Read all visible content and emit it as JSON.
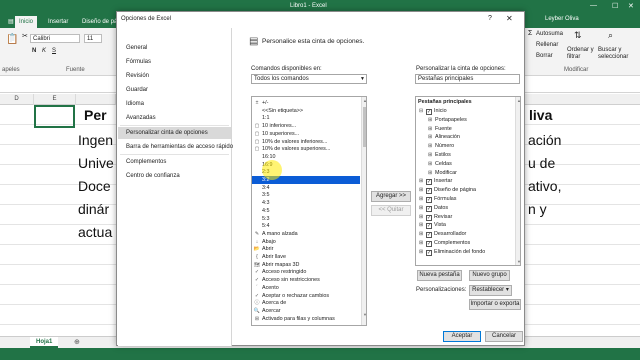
{
  "excel": {
    "window_title": "Libro1 - Excel",
    "user": "Leyber Oliva",
    "ribbon_tabs": [
      "Inicio",
      "Insertar",
      "Diseño de pá"
    ],
    "active_tab": "Inicio",
    "font_name": "Calibri",
    "font_size": "11",
    "clipboard_label": "apeles",
    "font_group_label": "Fuente",
    "autosum_label": "Autosuma",
    "fill_label": "Rellenar",
    "clear_label": "Borrar",
    "sort_label": "Ordenar y\nfiltrar",
    "find_label": "Buscar y\nseleccionar",
    "modify_group_label": "Modificar",
    "columns": [
      "D",
      "E"
    ],
    "doc_text": {
      "left_bold": "Per",
      "right_bold": "liva",
      "left_lines": [
        "Ingen",
        "Unive",
        "Doce",
        "dinár",
        "actua"
      ],
      "right_lines": [
        "ación",
        "u de",
        "ativo,",
        "n   y"
      ]
    },
    "sheet_tab": "Hoja1"
  },
  "dialog": {
    "title": "Opciones de Excel",
    "help": "?",
    "close": "✕",
    "nav": [
      "General",
      "Fórmulas",
      "Revisión",
      "Guardar",
      "Idioma",
      "Avanzadas",
      "Personalizar cinta de opciones",
      "Barra de herramientas de acceso rápido",
      "Complementos",
      "Centro de confianza"
    ],
    "selected_nav": "Personalizar cinta de opciones",
    "heading": "Personalice esta cinta de opciones.",
    "commands_label": "Comandos disponibles en:",
    "commands_value": "Todos los comandos",
    "customize_label": "Personalizar la cinta de opciones:",
    "customize_value": "Pestañas principales",
    "commands": [
      "+/-",
      "<<Sin etiqueta>>",
      "1:1",
      "10 inferiores...",
      "10 superiores...",
      "10% de valores inferiores...",
      "10% de valores superiores...",
      "16:10",
      "16:9",
      "2:3",
      "3:2",
      "3:4",
      "3:5",
      "4:3",
      "4:5",
      "5:3",
      "5:4",
      "A mano alzada",
      "Abajo",
      "Abrir",
      "Abrir llave",
      "Abrir mapas 3D",
      "Acceso restringido",
      "Acceso sin restricciones",
      "Acento",
      "Aceptar o rechazar cambios",
      "Acerca de",
      "Acercar",
      "Activado para filas y columnas"
    ],
    "highlighted_command_index": 10,
    "tree_header": "Pestañas principales",
    "tree": [
      {
        "label": "Inicio",
        "level": 1,
        "expander": "⊟",
        "checked": true
      },
      {
        "label": "Portapapeles",
        "level": 2,
        "expander": "⊞",
        "checked": null
      },
      {
        "label": "Fuente",
        "level": 2,
        "expander": "⊞",
        "checked": null
      },
      {
        "label": "Alineación",
        "level": 2,
        "expander": "⊞",
        "checked": null
      },
      {
        "label": "Número",
        "level": 2,
        "expander": "⊞",
        "checked": null
      },
      {
        "label": "Estilos",
        "level": 2,
        "expander": "⊞",
        "checked": null
      },
      {
        "label": "Celdas",
        "level": 2,
        "expander": "⊞",
        "checked": null
      },
      {
        "label": "Modificar",
        "level": 2,
        "expander": "⊞",
        "checked": null
      },
      {
        "label": "Insertar",
        "level": 1,
        "expander": "⊞",
        "checked": true
      },
      {
        "label": "Diseño de página",
        "level": 1,
        "expander": "⊞",
        "checked": true
      },
      {
        "label": "Fórmulas",
        "level": 1,
        "expander": "⊞",
        "checked": true
      },
      {
        "label": "Datos",
        "level": 1,
        "expander": "⊞",
        "checked": true
      },
      {
        "label": "Revisar",
        "level": 1,
        "expander": "⊞",
        "checked": true
      },
      {
        "label": "Vista",
        "level": 1,
        "expander": "⊞",
        "checked": true
      },
      {
        "label": "Desarrollador",
        "level": 1,
        "expander": "⊞",
        "checked": true
      },
      {
        "label": "Complementos",
        "level": 1,
        "expander": "⊞",
        "checked": true
      },
      {
        "label": "Eliminación del fondo",
        "level": 1,
        "expander": "⊞",
        "checked": true
      }
    ],
    "add_button": "Agregar >>",
    "remove_button": "<< Quitar",
    "new_tab_button": "Nueva pestaña",
    "new_group_button": "Nuevo grupo",
    "customizations_label": "Personalizaciones:",
    "restore_button": "Restablecer ▾",
    "import_export_button": "Importar o exporta",
    "ok_button": "Aceptar",
    "cancel_button": "Cancelar"
  },
  "colors": {
    "excel_green": "#217346",
    "selection_blue": "#0b5cd6",
    "nav_selected": "#d9d9d9"
  }
}
